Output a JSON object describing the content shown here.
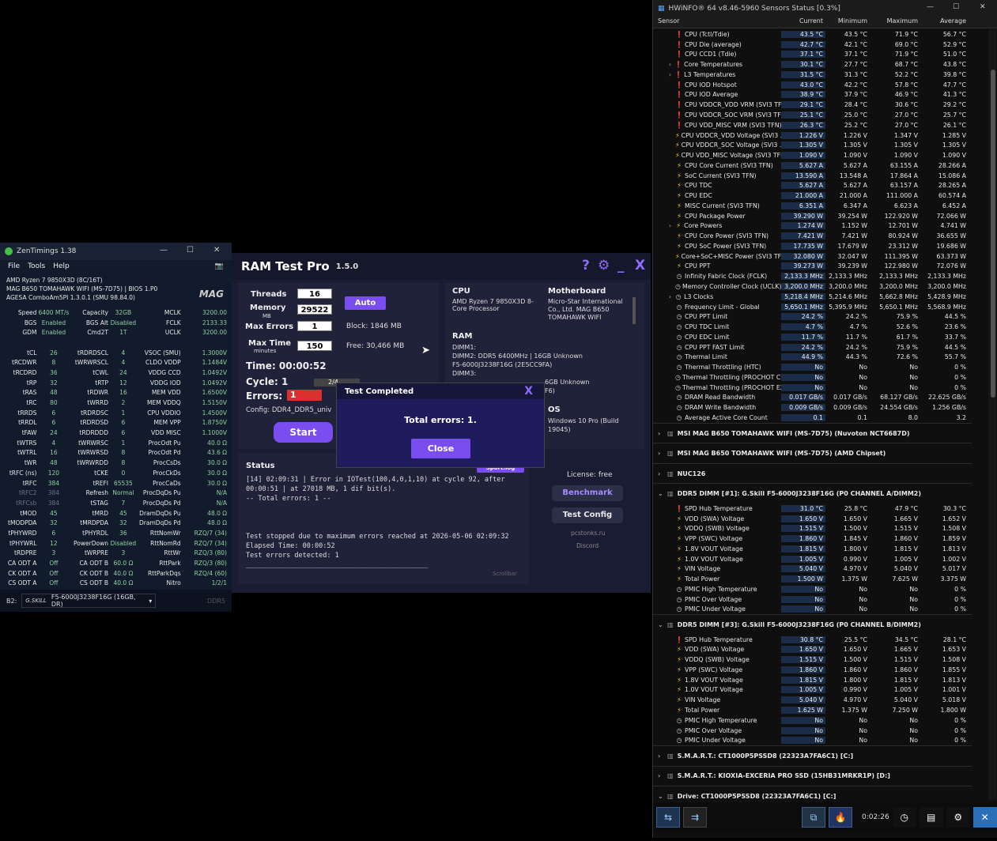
{
  "zentimings": {
    "title": "ZenTimings 1.38",
    "menu": [
      "File",
      "Tools",
      "Help"
    ],
    "info": [
      "AMD Ryzen 7 9850X3D (8C/16T)",
      "MAG B650 TOMAHAWK WIFI (MS-7D75) | BIOS 1.P0",
      "AGESA ComboAm5PI 1.3.0.1 (SMU 98.84.0)"
    ],
    "brand": "MAG",
    "rows": [
      [
        "Speed",
        "6400 MT/s",
        "Capacity",
        "32GB",
        "MCLK",
        "3200.00"
      ],
      [
        "BGS",
        "Enabled",
        "BGS Alt",
        "Disabled",
        "FCLK",
        "2133.33"
      ],
      [
        "GDM",
        "Enabled",
        "Cmd2T",
        "1T",
        "UCLK",
        "3200.00"
      ],
      [
        "",
        "",
        "",
        "",
        "",
        ""
      ],
      [
        "tCL",
        "26",
        "tRDRDSCL",
        "4",
        "VSOC (SMU)",
        "1.3000V"
      ],
      [
        "tRCDWR",
        "8",
        "tWRWRSCL",
        "4",
        "CLDO VDDP",
        "1.1484V"
      ],
      [
        "tRCDRD",
        "36",
        "tCWL",
        "24",
        "VDDG CCD",
        "1.0492V"
      ],
      [
        "tRP",
        "32",
        "tRTP",
        "12",
        "VDDG IOD",
        "1.0492V"
      ],
      [
        "tRAS",
        "48",
        "tRDWR",
        "16",
        "MEM VDD",
        "1.6500V"
      ],
      [
        "tRC",
        "80",
        "tWRRD",
        "2",
        "MEM VDDQ",
        "1.5150V"
      ],
      [
        "tRRDS",
        "6",
        "tRDRDSC",
        "1",
        "CPU VDDIO",
        "1.4500V"
      ],
      [
        "tRRDL",
        "6",
        "tRDRDSD",
        "6",
        "MEM VPP",
        "1.8750V"
      ],
      [
        "tFAW",
        "24",
        "tRDRDDD",
        "6",
        "VDD MISC",
        "1.1000V"
      ],
      [
        "tWTRS",
        "4",
        "tWRWRSC",
        "1",
        "ProcOdt Pu",
        "40.0 Ω"
      ],
      [
        "tWTRL",
        "16",
        "tWRWRSD",
        "8",
        "ProcOdt Pd",
        "43.6 Ω"
      ],
      [
        "tWR",
        "48",
        "tWRWRDD",
        "8",
        "ProcCsDs",
        "30.0 Ω"
      ],
      [
        "tRFC (ns)",
        "120",
        "tCKE",
        "0",
        "ProcCkDs",
        "30.0 Ω"
      ],
      [
        "tRFC",
        "384",
        "tREFI",
        "65535",
        "ProcCaDs",
        "30.0 Ω"
      ],
      [
        "tRFC2",
        "384",
        "Refresh",
        "Normal",
        "ProcDqDs Pu",
        "N/A"
      ],
      [
        "tRFCsb",
        "384",
        "tSTAG",
        "7",
        "ProcDqDs Pd",
        "N/A"
      ],
      [
        "tMOD",
        "45",
        "tMRD",
        "45",
        "DramDqDs Pu",
        "48.0 Ω"
      ],
      [
        "tMODPDA",
        "32",
        "tMRDPDA",
        "32",
        "DramDqDs Pd",
        "48.0 Ω"
      ],
      [
        "tPHYWRD",
        "6",
        "tPHYRDL",
        "36",
        "RttNomWr",
        "RZQ/7 (34)"
      ],
      [
        "tPHYWRL",
        "12",
        "PowerDown",
        "Disabled",
        "RttNomRd",
        "RZQ/7 (34)"
      ],
      [
        "tRDPRE",
        "3",
        "tWRPRE",
        "3",
        "RttWr",
        "RZQ/3 (80)"
      ],
      [
        "CA ODT A",
        "Off",
        "CA ODT B",
        "60.0 Ω",
        "RttPark",
        "RZQ/3 (80)"
      ],
      [
        "CK ODT A",
        "Off",
        "CK ODT B",
        "40.0 Ω",
        "RttParkDqs",
        "RZQ/4 (60)"
      ],
      [
        "CS ODT A",
        "Off",
        "CS ODT B",
        "40.0 Ω",
        "Nitro",
        "1/2/1"
      ]
    ],
    "slot": "B2:",
    "module": "F5-6000J3238F16G (16GB, DR)",
    "type": "DDR5"
  },
  "ramtest": {
    "title": "RAM Test Pro",
    "version": "1.5.0",
    "threads_label": "Threads",
    "threads": "16",
    "memory_label": "Memory",
    "memory_unit": "MB",
    "memory": "29522",
    "auto": "Auto",
    "maxerr_label": "Max Errors",
    "maxerr": "1",
    "block": "Block:  1846 MB",
    "maxtime_label": "Max Time",
    "maxtime_unit": "minutes",
    "maxtime": "150",
    "free": "Free:  30,466 MB",
    "time": "Time:  00:00:52",
    "cycle": "Cycle:  1",
    "cycle_prog": "2/4",
    "errors_label": "Errors:",
    "errors": "1",
    "config": "Config: DDR4_DDR5_univ",
    "start": "Start",
    "cpu_h": "CPU",
    "cpu": "AMD Ryzen 7 9850X3D 8-\nCore Processor",
    "mb_h": "Motherboard",
    "mb": "Micro-Star International\nCo., Ltd. MAG B650\nTOMAHAWK WIFI\n(MS-7D75)",
    "ram_h": "RAM",
    "ram": "DIMM1:\nDIMM2: DDR5 6400MHz | 16GB Unknown\nF5-6000J3238F16G (2E5CC9FA)\nDIMM3:",
    "ram2": "6GB Unknown\nF6)",
    "os_h": "OS",
    "os": "Windows 10 Pro (Build\n19045)",
    "status_h": "Status",
    "status_btn": "Sport.log",
    "log": "[14] 02:09:31 | Error in IOTest(100,4,0,1,10) at cycle 92, after\n00:00:51 | at 27018 MB, 1 dif bit(s).\n-- Total errors: 1 --\n\n\n\nTest stopped due to maximum errors reached at 2026-05-06 02:09:32\nElapsed Time: 00:00:52\nTest errors detected: 1\n_____________________________________________",
    "scrollbar": "Scrollbar",
    "license": "License: free",
    "benchmark": "Benchmark",
    "testconfig": "Test Config",
    "site": "pcstonks.ru",
    "discord": "Discord",
    "dlg_title": "Test Completed",
    "dlg_msg": "Total errors: 1.",
    "dlg_close": "Close",
    "dlg_x": "X"
  },
  "hwinfo": {
    "title": "HWiNFO® 64 v8.46-5960 Sensors Status [0.3%]",
    "cols": [
      "Sensor",
      "Current",
      "Minimum",
      "Maximum",
      "Average"
    ],
    "rows": [
      [
        "t",
        "CPU (Tctl/Tdie)",
        "43.5 °C",
        "43.5 °C",
        "71.9 °C",
        "56.7 °C"
      ],
      [
        "t",
        "CPU Die (average)",
        "42.7 °C",
        "42.1 °C",
        "69.0 °C",
        "52.9 °C"
      ],
      [
        "t",
        "CPU CCD1 (Tdie)",
        "37.1 °C",
        "37.1 °C",
        "71.9 °C",
        "51.0 °C"
      ],
      [
        "t>",
        "Core Temperatures",
        "30.1 °C",
        "27.7 °C",
        "68.7 °C",
        "43.8 °C"
      ],
      [
        "t>",
        "L3 Temperatures",
        "31.5 °C",
        "31.3 °C",
        "52.2 °C",
        "39.8 °C"
      ],
      [
        "t",
        "CPU IOD Hotspot",
        "43.0 °C",
        "42.2 °C",
        "57.8 °C",
        "47.7 °C"
      ],
      [
        "t",
        "CPU IOD Average",
        "38.9 °C",
        "37.9 °C",
        "46.9 °C",
        "41.3 °C"
      ],
      [
        "t",
        "CPU VDDCR_VDD VRM (SVI3 TFN)",
        "29.1 °C",
        "28.4 °C",
        "30.6 °C",
        "29.2 °C"
      ],
      [
        "t",
        "CPU VDDCR_SOC VRM (SVI3 TFN)",
        "25.1 °C",
        "25.0 °C",
        "27.0 °C",
        "25.7 °C"
      ],
      [
        "t",
        "CPU VDD_MISC VRM (SVI3 TFN)",
        "26.3 °C",
        "25.2 °C",
        "27.0 °C",
        "26.1 °C"
      ],
      [
        "v",
        "CPU VDDCR_VDD Voltage (SVI3 ...",
        "1.226 V",
        "1.226 V",
        "1.347 V",
        "1.285 V"
      ],
      [
        "v",
        "CPU VDDCR_SOC Voltage (SVI3 ...",
        "1.305 V",
        "1.305 V",
        "1.305 V",
        "1.305 V"
      ],
      [
        "v",
        "CPU VDD_MISC Voltage (SVI3 TFN)",
        "1.090 V",
        "1.090 V",
        "1.090 V",
        "1.090 V"
      ],
      [
        "v",
        "CPU Core Current (SVI3 TFN)",
        "5.627 A",
        "5.627 A",
        "63.155 A",
        "28.266 A"
      ],
      [
        "v",
        "SoC Current (SVI3 TFN)",
        "13.590 A",
        "13.548 A",
        "17.864 A",
        "15.086 A"
      ],
      [
        "v",
        "CPU TDC",
        "5.627 A",
        "5.627 A",
        "63.157 A",
        "28.265 A"
      ],
      [
        "v",
        "CPU EDC",
        "21.000 A",
        "21.000 A",
        "111.000 A",
        "60.574 A"
      ],
      [
        "v",
        "MISC Current (SVI3 TFN)",
        "6.351 A",
        "6.347 A",
        "6.623 A",
        "6.452 A"
      ],
      [
        "v",
        "CPU Package Power",
        "39.290 W",
        "39.254 W",
        "122.920 W",
        "72.066 W"
      ],
      [
        "v>",
        "Core Powers",
        "1.274 W",
        "1.152 W",
        "12.701 W",
        "4.741 W"
      ],
      [
        "v",
        "CPU Core Power (SVI3 TFN)",
        "7.421 W",
        "7.421 W",
        "80.924 W",
        "36.655 W"
      ],
      [
        "v",
        "CPU SoC Power (SVI3 TFN)",
        "17.735 W",
        "17.679 W",
        "23.312 W",
        "19.686 W"
      ],
      [
        "v",
        "Core+SoC+MISC Power (SVI3 TFN)",
        "32.080 W",
        "32.047 W",
        "111.395 W",
        "63.373 W"
      ],
      [
        "v",
        "CPU PPT",
        "39.273 W",
        "39.239 W",
        "122.980 W",
        "72.076 W"
      ],
      [
        "c",
        "Infinity Fabric Clock (FCLK)",
        "2,133.3 MHz",
        "2,133.3 MHz",
        "2,133.3 MHz",
        "2,133.3 MHz"
      ],
      [
        "c",
        "Memory Controller Clock (UCLK)",
        "3,200.0 MHz",
        "3,200.0 MHz",
        "3,200.0 MHz",
        "3,200.0 MHz"
      ],
      [
        "c>",
        "L3 Clocks",
        "5,218.4 MHz",
        "5,214.6 MHz",
        "5,662.8 MHz",
        "5,428.9 MHz"
      ],
      [
        "c",
        "Frequency Limit - Global",
        "5,650.1 MHz",
        "5,395.9 MHz",
        "5,650.1 MHz",
        "5,568.9 MHz"
      ],
      [
        "c",
        "CPU PPT Limit",
        "24.2 %",
        "24.2 %",
        "75.9 %",
        "44.5 %"
      ],
      [
        "c",
        "CPU TDC Limit",
        "4.7 %",
        "4.7 %",
        "52.6 %",
        "23.6 %"
      ],
      [
        "c",
        "CPU EDC Limit",
        "11.7 %",
        "11.7 %",
        "61.7 %",
        "33.7 %"
      ],
      [
        "c",
        "CPU PPT FAST Limit",
        "24.2 %",
        "24.2 %",
        "75.9 %",
        "44.5 %"
      ],
      [
        "c",
        "Thermal Limit",
        "44.9 %",
        "44.3 %",
        "72.6 %",
        "55.7 %"
      ],
      [
        "c",
        "Thermal Throttling (HTC)",
        "No",
        "No",
        "No",
        "0 %"
      ],
      [
        "c",
        "Thermal Throttling (PROCHOT CPU)",
        "No",
        "No",
        "No",
        "0 %"
      ],
      [
        "c",
        "Thermal Throttling (PROCHOT EXT)",
        "No",
        "No",
        "No",
        "0 %"
      ],
      [
        "c",
        "DRAM Read Bandwidth",
        "0.017 GB/s",
        "0.017 GB/s",
        "68.127 GB/s",
        "22.625 GB/s"
      ],
      [
        "c",
        "DRAM Write Bandwidth",
        "0.009 GB/s",
        "0.009 GB/s",
        "24.554 GB/s",
        "1.256 GB/s"
      ],
      [
        "c",
        "Average Active Core Count",
        "0.1",
        "0.1",
        "8.0",
        "3.2"
      ]
    ],
    "groups1": [
      "MSI MAG B650 TOMAHAWK WIFI (MS-7D75) (Nuvoton NCT6687D)",
      "MSI MAG B650 TOMAHAWK WIFI (MS-7D75) (AMD Chipset)",
      "NUC126"
    ],
    "dimm1": "DDR5 DIMM [#1]: G.Skill F5-6000J3238F16G (P0 CHANNEL A/DIMM2)",
    "dimm1_rows": [
      [
        "t",
        "SPD Hub Temperature",
        "31.0 °C",
        "25.8 °C",
        "47.9 °C",
        "30.3 °C"
      ],
      [
        "v",
        "VDD (SWA) Voltage",
        "1.650 V",
        "1.650 V",
        "1.665 V",
        "1.652 V"
      ],
      [
        "v",
        "VDDQ (SWB) Voltage",
        "1.515 V",
        "1.500 V",
        "1.515 V",
        "1.508 V"
      ],
      [
        "v",
        "VPP (SWC) Voltage",
        "1.860 V",
        "1.845 V",
        "1.860 V",
        "1.859 V"
      ],
      [
        "v",
        "1.8V VOUT Voltage",
        "1.815 V",
        "1.800 V",
        "1.815 V",
        "1.813 V"
      ],
      [
        "v",
        "1.0V VOUT Voltage",
        "1.005 V",
        "0.990 V",
        "1.005 V",
        "1.002 V"
      ],
      [
        "v",
        "VIN Voltage",
        "5.040 V",
        "4.970 V",
        "5.040 V",
        "5.017 V"
      ],
      [
        "v",
        "Total Power",
        "1.500 W",
        "1.375 W",
        "7.625 W",
        "3.375 W"
      ],
      [
        "c",
        "PMIC High Temperature",
        "No",
        "No",
        "No",
        "0 %"
      ],
      [
        "c",
        "PMIC Over Voltage",
        "No",
        "No",
        "No",
        "0 %"
      ],
      [
        "c",
        "PMIC Under Voltage",
        "No",
        "No",
        "No",
        "0 %"
      ]
    ],
    "dimm3": "DDR5 DIMM [#3]: G.Skill F5-6000J3238F16G (P0 CHANNEL B/DIMM2)",
    "dimm3_rows": [
      [
        "t",
        "SPD Hub Temperature",
        "30.8 °C",
        "25.5 °C",
        "34.5 °C",
        "28.1 °C"
      ],
      [
        "v",
        "VDD (SWA) Voltage",
        "1.650 V",
        "1.650 V",
        "1.665 V",
        "1.653 V"
      ],
      [
        "v",
        "VDDQ (SWB) Voltage",
        "1.515 V",
        "1.500 V",
        "1.515 V",
        "1.508 V"
      ],
      [
        "v",
        "VPP (SWC) Voltage",
        "1.860 V",
        "1.860 V",
        "1.860 V",
        "1.855 V"
      ],
      [
        "v",
        "1.8V VOUT Voltage",
        "1.815 V",
        "1.800 V",
        "1.815 V",
        "1.813 V"
      ],
      [
        "v",
        "1.0V VOUT Voltage",
        "1.005 V",
        "0.990 V",
        "1.005 V",
        "1.001 V"
      ],
      [
        "v",
        "VIN Voltage",
        "5.040 V",
        "4.970 V",
        "5.040 V",
        "5.018 V"
      ],
      [
        "v",
        "Total Power",
        "1.625 W",
        "1.375 W",
        "7.250 W",
        "1.800 W"
      ],
      [
        "c",
        "PMIC High Temperature",
        "No",
        "No",
        "No",
        "0 %"
      ],
      [
        "c",
        "PMIC Over Voltage",
        "No",
        "No",
        "No",
        "0 %"
      ],
      [
        "c",
        "PMIC Under Voltage",
        "No",
        "No",
        "No",
        "0 %"
      ]
    ],
    "groups2": [
      "S.M.A.R.T.: CT1000P5PSSD8 (22323A7FA6C1) [C:]",
      "S.M.A.R.T.: KIOXIA-EXCERIA PRO SSD (15HB31MRKR1P) [D:]",
      "Drive: CT1000P5PSSD8 (22323A7FA6C1) [C:]"
    ],
    "timer": "0:02:26"
  }
}
